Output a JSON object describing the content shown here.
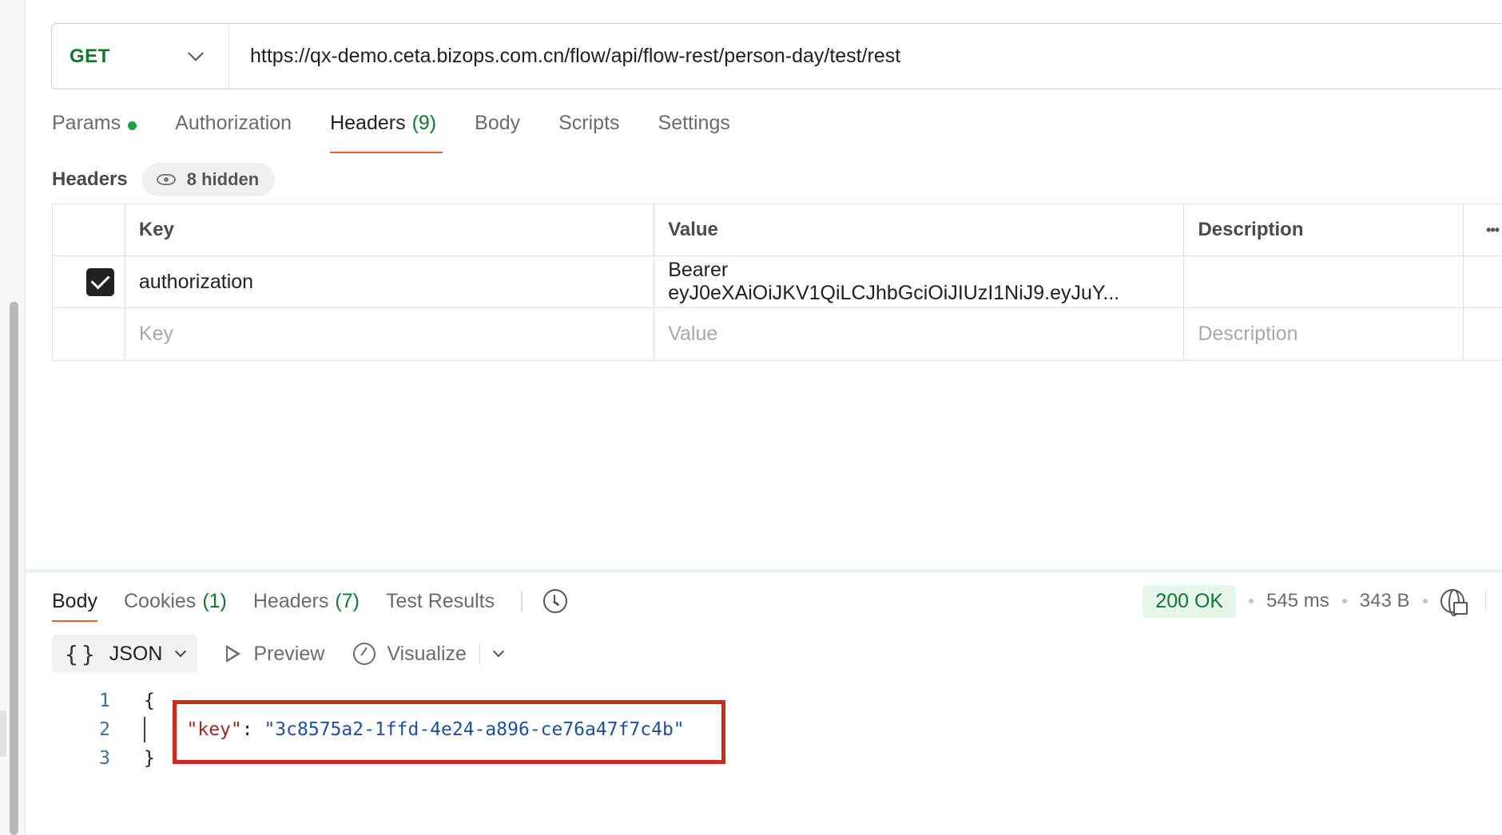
{
  "request": {
    "method": "GET",
    "url": "https://qx-demo.ceta.bizops.com.cn/flow/api/flow-rest/person-day/test/rest"
  },
  "request_tabs": [
    {
      "label": "Params",
      "count": "",
      "dot": true
    },
    {
      "label": "Authorization",
      "count": ""
    },
    {
      "label": "Headers",
      "count": "(9)"
    },
    {
      "label": "Body",
      "count": ""
    },
    {
      "label": "Scripts",
      "count": ""
    },
    {
      "label": "Settings",
      "count": ""
    }
  ],
  "headers_section": {
    "title": "Headers",
    "hidden_label": "8 hidden",
    "columns": {
      "key": "Key",
      "value": "Value",
      "description": "Description"
    },
    "rows": [
      {
        "checked": true,
        "key": "authorization",
        "value": "Bearer eyJ0eXAiOiJKV1QiLCJhbGciOiJIUzI1NiJ9.eyJuY...",
        "description": ""
      }
    ],
    "placeholders": {
      "key": "Key",
      "value": "Value",
      "description": "Description"
    }
  },
  "response_tabs": [
    {
      "label": "Body",
      "count": ""
    },
    {
      "label": "Cookies",
      "count": "(1)"
    },
    {
      "label": "Headers",
      "count": "(7)"
    },
    {
      "label": "Test Results",
      "count": ""
    }
  ],
  "response_status": {
    "status": "200 OK",
    "time": "545 ms",
    "size": "343 B",
    "status_color": "#0b7a2c"
  },
  "response_toolbar": {
    "format_icon": "{}",
    "format": "JSON",
    "preview": "Preview",
    "visualize": "Visualize"
  },
  "response_body": {
    "line_numbers": [
      "1",
      "2",
      "3"
    ],
    "open_brace": "{",
    "close_brace": "}",
    "key": "\"key\"",
    "colon": ": ",
    "value": "\"3c8575a2-1ffd-4e24-a896-ce76a47f7c4b\""
  },
  "colors": {
    "accent": "#e8612c",
    "highlight_box": "#d02a1e"
  }
}
